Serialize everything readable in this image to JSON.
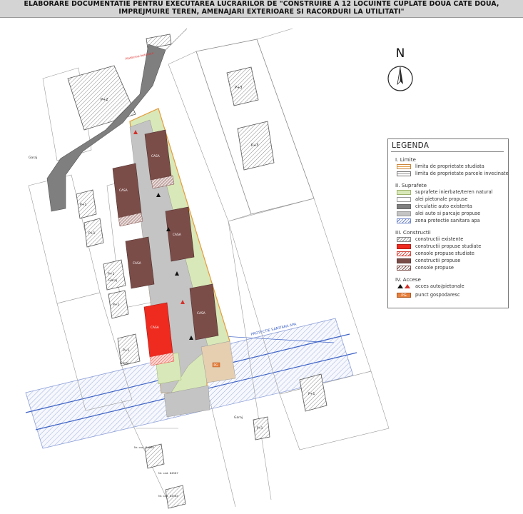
{
  "title": {
    "line1": "ELABORARE DOCUMENTATIE PENTRU EXECUTAREA LUCRARILOR DE \"CONSTRUIRE A 12 LOCUINTE CUPLATE DOUA CATE DOUA,",
    "line2": "IMPREJMUIRE TEREN, AMENAJARI EXTERIOARE SI RACORDURI LA UTILITATI\""
  },
  "north": {
    "letter": "N"
  },
  "legend": {
    "title": "LEGENDA",
    "sections": [
      {
        "heading": "I. Limite",
        "items": [
          {
            "style": "limit1",
            "label": "limita de proprietate studiata"
          },
          {
            "style": "limit2",
            "label": "limita de proprietate parcele invecinate"
          }
        ]
      },
      {
        "heading": "II. Suprafete",
        "items": [
          {
            "style": "green",
            "label": "suprafete inierbate/teren natural"
          },
          {
            "style": "white",
            "label": "alei pietonale propuse"
          },
          {
            "style": "dgray",
            "label": "circulatie auto existenta"
          },
          {
            "style": "lgray",
            "label": "alei auto si parcaje propuse"
          },
          {
            "style": "hatchblue",
            "label": "zona protectie sanitara apa"
          }
        ]
      },
      {
        "heading": "III. Constructii",
        "items": [
          {
            "style": "hatchgray",
            "label": "constructii existente"
          },
          {
            "style": "red",
            "label": "constructii propuse studiate"
          },
          {
            "style": "hatchred",
            "label": "console propuse studiate"
          },
          {
            "style": "brown",
            "label": "constructii propuse"
          },
          {
            "style": "hatchbrown",
            "label": "console propuse"
          }
        ]
      },
      {
        "heading": "IV. Accese",
        "items": [
          {
            "style": "arrows",
            "label": "acces auto/pietonale"
          },
          {
            "style": "pg",
            "swatch_text": "PG",
            "label": "punct gospodaresc"
          }
        ]
      }
    ]
  },
  "map": {
    "labels": {
      "p2_a": "P+2",
      "p3_a": "P+3",
      "p3_b": "P+3",
      "p1_a": "P+1",
      "p1_b": "P+1",
      "p1_c": "P+1",
      "p1_d": "P+1",
      "p1_e": "P+1",
      "p1_f": "P+1",
      "p_a": "P+1",
      "garaj_a": "Garaj",
      "garaj_b": "Garaj",
      "garaj_c": "Garaj",
      "garaj_d": "Garaj",
      "casa": "CASA",
      "pg": "PG",
      "cad1": "Nr. cad. 84580",
      "cad2": "Nr. cad. 84587",
      "cad3": "Nr. cad. 84584",
      "platform": "Platforma betonata",
      "zone": "PROTECTIE SANITARA APA"
    }
  },
  "colors": {
    "header_bg": "#d4d4d4",
    "road": "#7f7f7f",
    "alley": "#c4c4c4",
    "green": "#d9e8b8",
    "proposed": "#7b4d49",
    "studied": "#ef2a1f",
    "water_zone": "#6d84c9",
    "pg": "#e7803c"
  }
}
